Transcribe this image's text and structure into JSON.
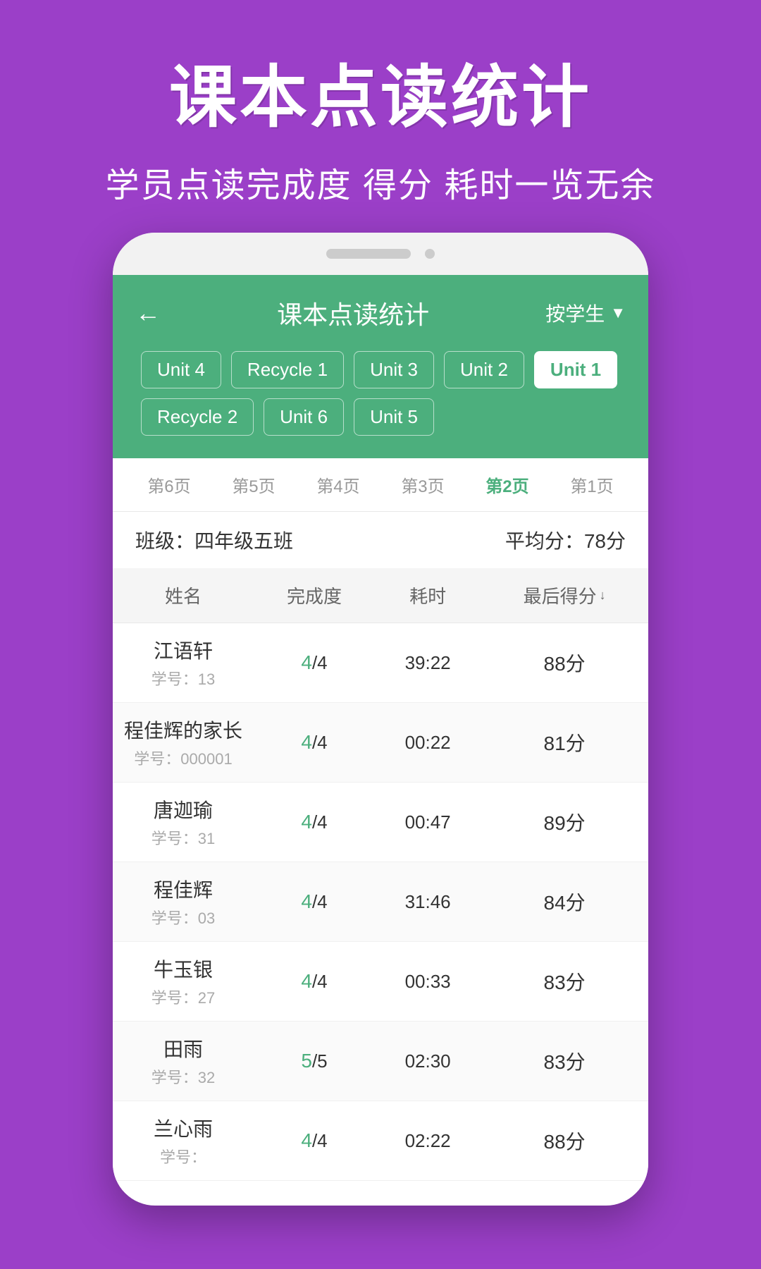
{
  "background": {
    "color": "#9b3fc8"
  },
  "hero": {
    "title": "课本点读统计",
    "subtitle": "学员点读完成度 得分 耗时一览无余"
  },
  "phone": {
    "app": {
      "header": {
        "title": "课本点读统计",
        "filter_label": "按学生",
        "back_icon": "←"
      },
      "unit_tabs": [
        {
          "label": "Unit 4",
          "active": false
        },
        {
          "label": "Recycle 1",
          "active": false
        },
        {
          "label": "Unit 3",
          "active": false
        },
        {
          "label": "Unit 2",
          "active": false
        },
        {
          "label": "Unit 1",
          "active": true
        },
        {
          "label": "Recycle 2",
          "active": false
        },
        {
          "label": "Unit 6",
          "active": false
        },
        {
          "label": "Unit 5",
          "active": false
        }
      ],
      "page_tabs": [
        {
          "label": "第6页",
          "active": false
        },
        {
          "label": "第5页",
          "active": false
        },
        {
          "label": "第4页",
          "active": false
        },
        {
          "label": "第3页",
          "active": false
        },
        {
          "label": "第2页",
          "active": true
        },
        {
          "label": "第1页",
          "active": false
        }
      ],
      "class_info": {
        "class_name": "班级：四年级五班",
        "avg_score": "平均分：78分"
      },
      "table": {
        "columns": [
          "姓名",
          "完成度",
          "耗时",
          "最后得分"
        ],
        "rows": [
          {
            "name": "江语轩",
            "id": "学号：13",
            "completion": "4",
            "total": "4",
            "time": "39:22",
            "score": "88分"
          },
          {
            "name": "程佳辉的家长",
            "id": "学号：000001",
            "completion": "4",
            "total": "4",
            "time": "00:22",
            "score": "81分"
          },
          {
            "name": "唐迦瑜",
            "id": "学号：31",
            "completion": "4",
            "total": "4",
            "time": "00:47",
            "score": "89分"
          },
          {
            "name": "程佳辉",
            "id": "学号：03",
            "completion": "4",
            "total": "4",
            "time": "31:46",
            "score": "84分"
          },
          {
            "name": "牛玉银",
            "id": "学号：27",
            "completion": "4",
            "total": "4",
            "time": "00:33",
            "score": "83分"
          },
          {
            "name": "田雨",
            "id": "学号：32",
            "completion": "5",
            "total": "5",
            "time": "02:30",
            "score": "83分"
          },
          {
            "name": "兰心雨",
            "id": "学号：",
            "completion": "4",
            "total": "4",
            "time": "02:22",
            "score": "88分"
          }
        ]
      }
    }
  }
}
